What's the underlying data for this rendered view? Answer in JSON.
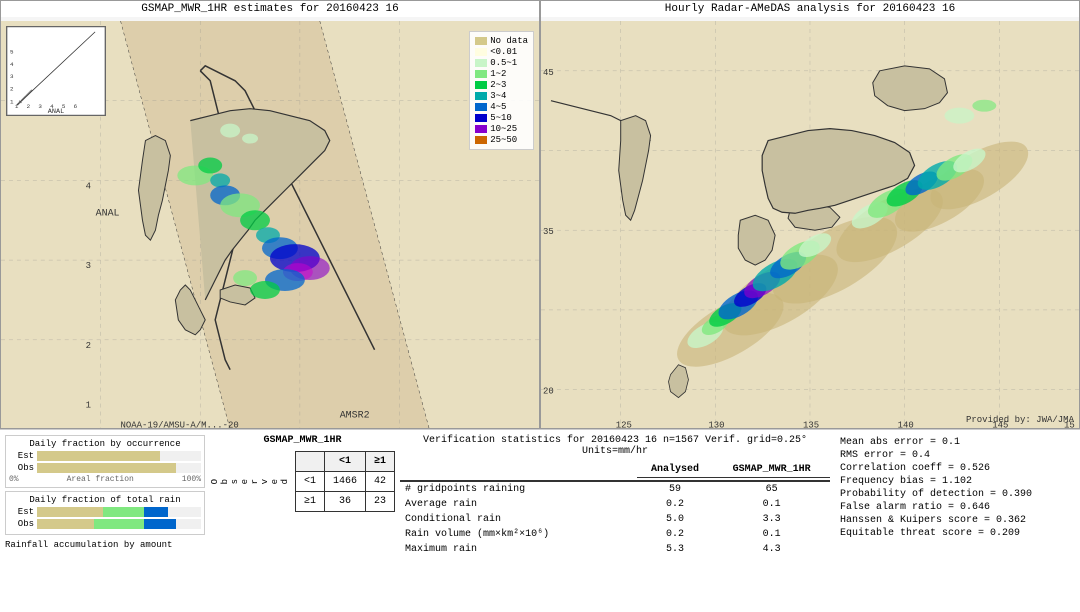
{
  "left_map": {
    "title": "GSMAP_MWR_1HR estimates for 20160423 16",
    "amsr2_label": "AMSR2",
    "noaa_label": "NOAA-19/AMSU-A/M...-20"
  },
  "right_map": {
    "title": "Hourly Radar-AMeDAS analysis for 20160423 16",
    "provided_by": "Provided by: JWA/JMA",
    "lat_labels": [
      "45",
      "35",
      "20"
    ],
    "lon_labels": [
      "125",
      "130",
      "135",
      "140",
      "145",
      "15"
    ]
  },
  "legend": {
    "items": [
      {
        "label": "No data",
        "color": "#d4c98a"
      },
      {
        "label": "<0.01",
        "color": "#fffde0"
      },
      {
        "label": "0.5~1",
        "color": "#c8f5c8"
      },
      {
        "label": "1~2",
        "color": "#80e880"
      },
      {
        "label": "2~3",
        "color": "#00cc44"
      },
      {
        "label": "3~4",
        "color": "#00aaaa"
      },
      {
        "label": "4~5",
        "color": "#0066cc"
      },
      {
        "label": "5~10",
        "color": "#0000cc"
      },
      {
        "label": "10~25",
        "color": "#8800cc"
      },
      {
        "label": "25~50",
        "color": "#cc6600"
      }
    ]
  },
  "charts": {
    "fraction_title": "Daily fraction by occurrence",
    "rain_title": "Daily fraction of total rain",
    "rainfall_title": "Rainfall accumulation by amount",
    "est_label": "Est",
    "obs_label": "Obs",
    "x_axis": [
      "0%",
      "Areal fraction",
      "100%"
    ],
    "est_bar_width": 75,
    "obs_bar_width": 85
  },
  "contingency": {
    "title": "GSMAP_MWR_1HR",
    "observed_label": "O\nb\ns\ne\nr\nv\ne\nd",
    "col_lt1": "<1",
    "col_ge1": "≥1",
    "row_lt1": "<1",
    "row_ge1": "≥1",
    "cell_11": "1466",
    "cell_12": "42",
    "cell_21": "36",
    "cell_22": "23"
  },
  "verification": {
    "title": "Verification statistics for 20160423 16  n=1567  Verif. grid=0.25°  Units=mm/hr",
    "col1_header": "Analysed",
    "col2_header": "GSMAP_MWR_1HR",
    "rows": [
      {
        "label": "# gridpoints raining",
        "val1": "59",
        "val2": "65"
      },
      {
        "label": "Average rain",
        "val1": "0.2",
        "val2": "0.1"
      },
      {
        "label": "Conditional rain",
        "val1": "5.0",
        "val2": "3.3"
      },
      {
        "label": "Rain volume (mm×km²×10⁶)",
        "val1": "0.2",
        "val2": "0.1"
      },
      {
        "label": "Maximum rain",
        "val1": "5.3",
        "val2": "4.3"
      }
    ]
  },
  "stats": {
    "mean_abs_error": "Mean abs error = 0.1",
    "rms_error": "RMS error = 0.4",
    "correlation": "Correlation coeff = 0.526",
    "freq_bias": "Frequency bias = 1.102",
    "prob_detection": "Probability of detection = 0.390",
    "false_alarm": "False alarm ratio = 0.646",
    "hanssen_kuipers": "Hanssen & Kuipers score = 0.362",
    "equitable_threat": "Equitable threat score = 0.209"
  }
}
